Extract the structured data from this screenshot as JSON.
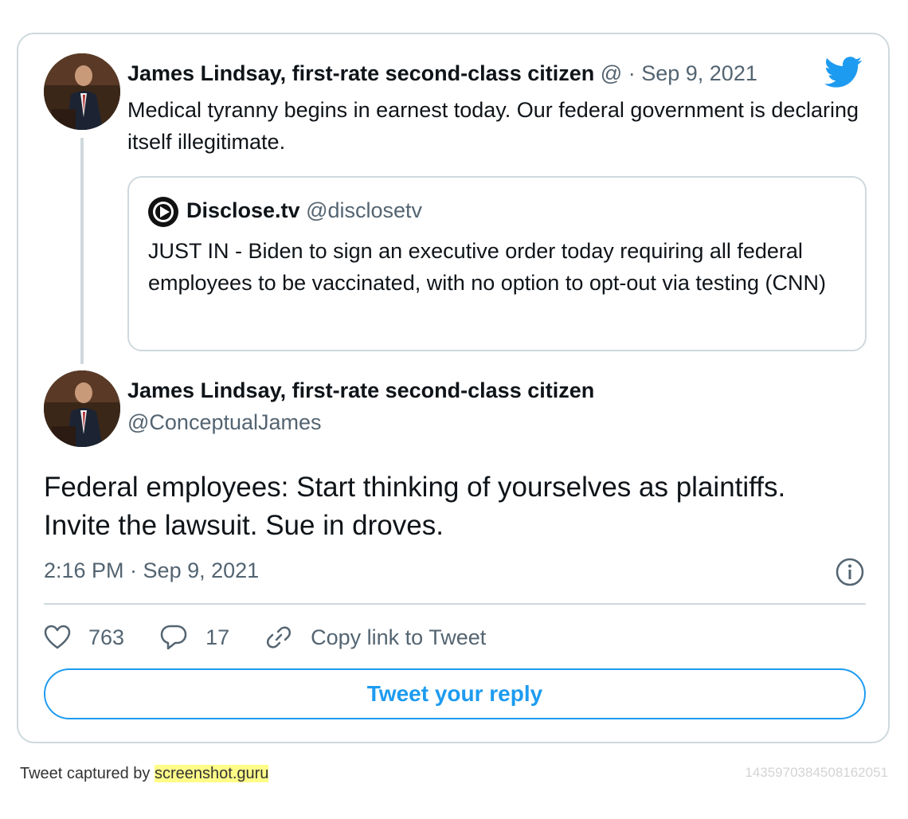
{
  "parent_tweet": {
    "author_name": "James Lindsay, first-rate second-class citizen",
    "handle_at": "@",
    "separator": "·",
    "date": "Sep 9, 2021",
    "text": "Medical tyranny begins in earnest today. Our federal government is declaring itself illegitimate.",
    "quoted": {
      "name": "Disclose.tv",
      "handle": "@disclosetv",
      "text": "JUST IN - Biden to sign an executive order today requiring all federal employees to be vaccinated, with no option to opt-out via testing (CNN)"
    }
  },
  "main_tweet": {
    "author_name": "James Lindsay, first-rate second-class citizen",
    "handle": "@ConceptualJames",
    "text": "Federal employees: Start thinking of yourselves as plaintiffs. Invite the lawsuit. Sue in droves.",
    "timestamp": "2:16 PM · Sep 9, 2021",
    "likes": "763",
    "replies": "17",
    "copy_link_label": "Copy link to Tweet",
    "reply_button_label": "Tweet your reply"
  },
  "footer": {
    "captured_by": "Tweet captured by ",
    "service": "screenshot.guru",
    "tweet_id": "1435970384508162051"
  },
  "colors": {
    "accent": "#1d9bf0",
    "border": "#cfd9de",
    "muted_text": "#536471",
    "highlight": "#fffc88"
  },
  "icons": [
    "twitter-bird-icon",
    "disclosetv-logo-icon",
    "info-icon",
    "heart-icon",
    "reply-bubble-icon",
    "link-icon"
  ]
}
